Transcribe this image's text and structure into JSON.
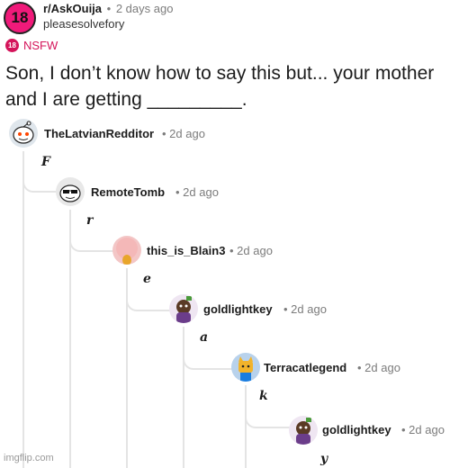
{
  "post": {
    "subreddit_icon": "18",
    "subreddit": "r/AskOuija",
    "separator": "•",
    "time": "2 days ago",
    "author": "pleasesolvefory",
    "nsfw_icon": "18",
    "nsfw_label": "NSFW",
    "title_line1": "Son, I don’t know how to say this but... your mother",
    "title_line2": "and I are getting _________."
  },
  "comments": [
    {
      "username": "TheLatvianRedditor",
      "time": "• 2d ago",
      "letter": "F",
      "avatar": "snoo-icon"
    },
    {
      "username": "RemoteTomb",
      "time": "• 2d ago",
      "letter": "r",
      "avatar": "sunglasses-snoo-icon"
    },
    {
      "username": "this_is_Blain3",
      "time": "• 2d ago",
      "letter": "e",
      "avatar": "pink-face-icon"
    },
    {
      "username": "goldlightkey",
      "time": "• 2d ago",
      "letter": "a",
      "avatar": "purple-snoo-icon"
    },
    {
      "username": "Terracatlegend",
      "time": "• 2d ago",
      "letter": "k",
      "avatar": "yellow-cat-icon"
    },
    {
      "username": "goldlightkey",
      "time": "• 2d ago",
      "letter": "y",
      "avatar": "purple-snoo-icon"
    }
  ],
  "watermark": "imgflip.com",
  "colors": {
    "nsfw": "#d4145a",
    "subreddit_icon_bg": "#f01a7a",
    "muted": "#7c7c7c",
    "thread_line": "#e4e4e4"
  }
}
